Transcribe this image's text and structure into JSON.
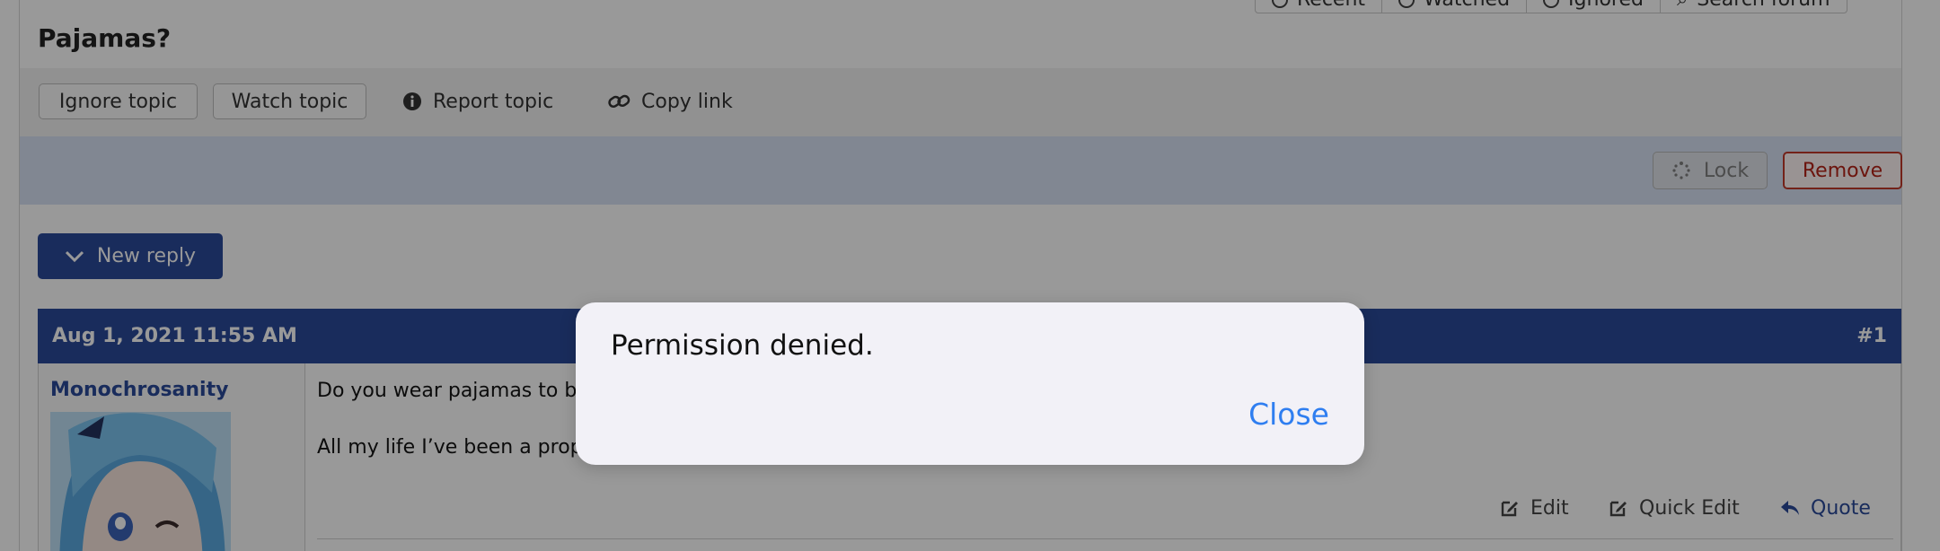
{
  "topnav": {
    "items": [
      "Recent",
      "Watched",
      "Ignored",
      "Search forum"
    ]
  },
  "topic": {
    "title": "Pajamas?"
  },
  "actions": {
    "ignore": "Ignore topic",
    "watch": "Watch topic",
    "report": "Report topic",
    "copy": "Copy link"
  },
  "moderation": {
    "lock": "Lock",
    "remove": "Remove"
  },
  "new_reply": "New reply",
  "post": {
    "date": "Aug 1, 2021 11:55 AM",
    "number": "#1",
    "author": "Monochrosanity",
    "line1": "Do you wear pajamas to b",
    "line2": "All my life I’ve been a prop",
    "edit": "Edit",
    "quick_edit": "Quick Edit",
    "quote": "Quote"
  },
  "dialog": {
    "message": "Permission denied.",
    "close": "Close"
  },
  "colors": {
    "accent": "#2a4a9a",
    "danger": "#c0392b",
    "dialog_link": "#2f7ef0"
  }
}
